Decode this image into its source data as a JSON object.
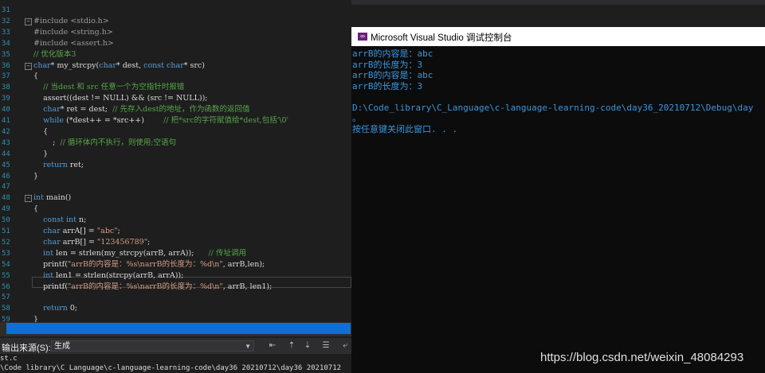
{
  "editor": {
    "line_numbers": [
      "31",
      "32",
      "33",
      "34",
      "35",
      "36",
      "37",
      "38",
      "39",
      "40",
      "41",
      "42",
      "43",
      "44",
      "45",
      "46",
      "47",
      "48",
      "49",
      "50",
      "51",
      "52",
      "53",
      "54",
      "55",
      "56",
      "57",
      "58",
      "59",
      "60"
    ],
    "lines": [
      "",
      "#include <stdio.h>",
      "#include <string.h>",
      "#include <assert.h>",
      "// 优化版本3",
      "char* my_strcpy(char* dest, const char* src)",
      "{",
      "    // 当dest 和 src 任意一个为空指针时报错",
      "    assert((dest != NULL) && (src != NULL));",
      "    char* ret = dest;  // 先存入dest的地址，作为函数的返回值",
      "    while (*dest++ = *src++)        // 把*src的字符赋值给*dest,包括'\\0'",
      "    {",
      "        ;  // 循环体内不执行，则使用;空语句",
      "    }",
      "    return ret;",
      "}",
      "",
      "int main()",
      "{",
      "    const int n;",
      "    char arrA[] = \"abc\";",
      "    char arrB[] = \"123456789\";",
      "    int len = strlen(my_strcpy(arrB, arrA));      // 传址调用",
      "    printf(\"arrB的内容是：%s\\narrB的长度为：%d\\n\", arrB,len);",
      "    int len1 = strlen(strcpy(arrB, arrA));",
      "    printf(\"arrB的内容是：%s\\narrB的长度为：%d\\n\", arrB, len1);",
      "",
      "    return 0;",
      "}",
      ""
    ]
  },
  "output_panel": {
    "label": "输出来源(S):",
    "selected": "生成",
    "lines": [
      "st.c",
      "\\Code library\\C Language\\c-language-learning-code\\day36 20210712\\day36 20210712"
    ]
  },
  "console": {
    "title": "Microsoft Visual Studio 调试控制台",
    "lines": [
      "arrB的内容是：abc",
      "arrB的长度为：3",
      "arrB的内容是：abc",
      "arrB的长度为：3",
      "",
      "D:\\Code_library\\C_Language\\c-language-learning-code\\day36_20210712\\Debug\\day",
      "。",
      "按任意键关闭此窗口. . ."
    ]
  },
  "watermark": "https://blog.csdn.net/weixin_48084293",
  "colors": {
    "console_text": "#3a96dd",
    "editor_bg": "#1e1e1e",
    "scroll_thumb": "#0e6fd8"
  }
}
